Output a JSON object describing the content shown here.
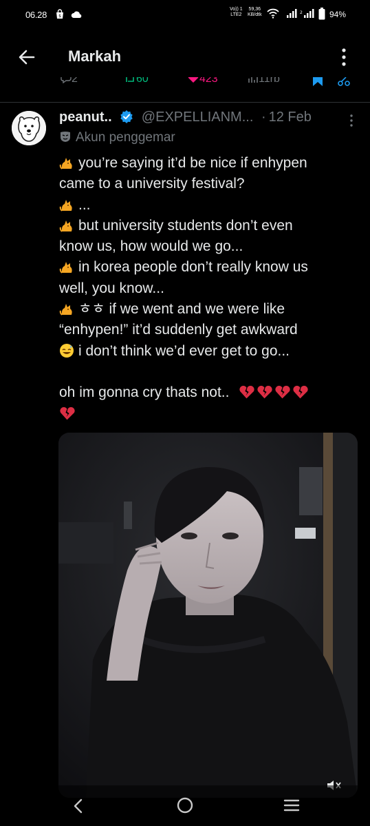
{
  "status_bar": {
    "time": "06.28",
    "network_top": "Vo)) 1",
    "network_bottom": "LTE2",
    "speed_top": "59,36",
    "speed_bottom": "KB/dtk",
    "battery": "94%"
  },
  "header": {
    "title": "Markah"
  },
  "prev_actions": {
    "replies": "2",
    "reposts": "60",
    "likes": "423",
    "views": "11rb"
  },
  "tweet": {
    "display_name": "peanut..",
    "handle": "@EXPELLIANM...",
    "separator": "·",
    "date": "12 Feb",
    "account_label": "Akun penggemar",
    "lines": [
      "you’re saying it’d be nice if enhypen",
      "came to a university festival?",
      "...",
      "but university students don’t even",
      "know us, how would we go...",
      "in korea people don’t really know us",
      "well, you know...",
      "ㅎㅎ if we went and we were like",
      "“enhypen!” it’d suddenly get awkward",
      "i don’t think we’d ever get to go...",
      "",
      "oh im gonna cry thats not.."
    ]
  },
  "colors": {
    "background": "#000000",
    "text": "#e7e9ea",
    "secondary": "#71767b",
    "accent": "#1d9bf0",
    "like": "#f91880",
    "repost": "#00ba7c"
  }
}
